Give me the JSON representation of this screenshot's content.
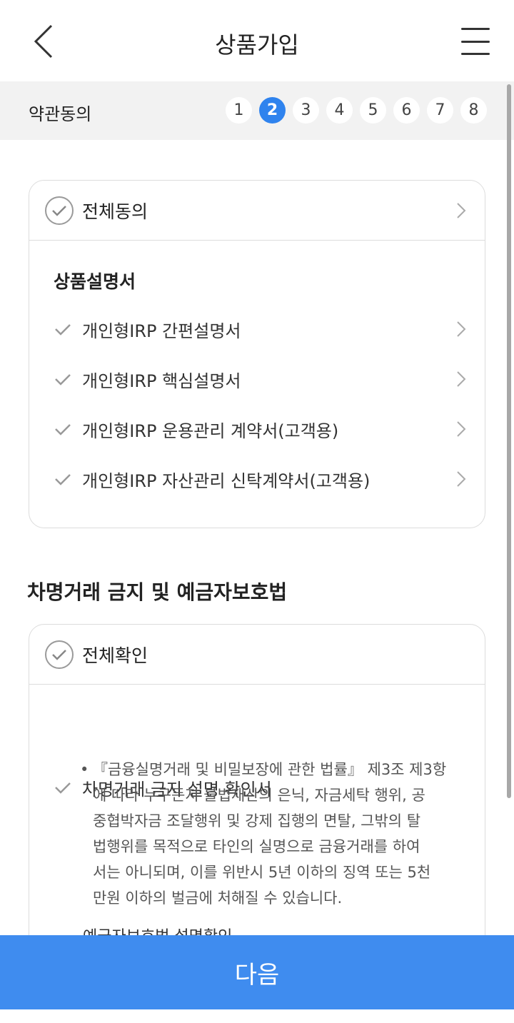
{
  "header": {
    "title": "상품가입",
    "back_icon": "chevron-left-icon",
    "menu_icon": "hamburger-menu-icon"
  },
  "stepbar": {
    "label": "약관동의",
    "steps": [
      "1",
      "2",
      "3",
      "4",
      "5",
      "6",
      "7",
      "8"
    ],
    "active_step": "2",
    "active_color": "#2f83ee"
  },
  "agree_card": {
    "all_label": "전체동의",
    "section_title": "상품설명서",
    "items": [
      "개인형IRP 간편설명서",
      "개인형IRP 핵심설명서",
      "개인형IRP 운용관리 계약서(고객용)",
      "개인형IRP 자산관리 신탁계약서(고객용)"
    ]
  },
  "confirm_section": {
    "title": "차명거래 금지 및 예금자보호법",
    "all_label": "전체확인",
    "item_label": "차명거래 금지 설명 확인서",
    "description_lines": [
      "『금융실명거래 및 비밀보장에 관한 법률』 제3조 제3항",
      "에 따라 누구든지 불법재산의 은닉, 자금세탁 행위, 공",
      "중협박자금 조달행위 및 강제 집행의 면탈, 그밖의 탈",
      "법행위를 목적으로 타인의 실명으로 금융거래를 하여",
      "서는 아니되며, 이를 위반시 5년 이하의 징역 또는 5천",
      "만원 이하의 벌금에 처해질 수 있습니다."
    ],
    "next_item_partial": "예금자보호법 설명확인"
  },
  "bottom": {
    "next_label": "다음",
    "button_color": "#3f8cef"
  }
}
